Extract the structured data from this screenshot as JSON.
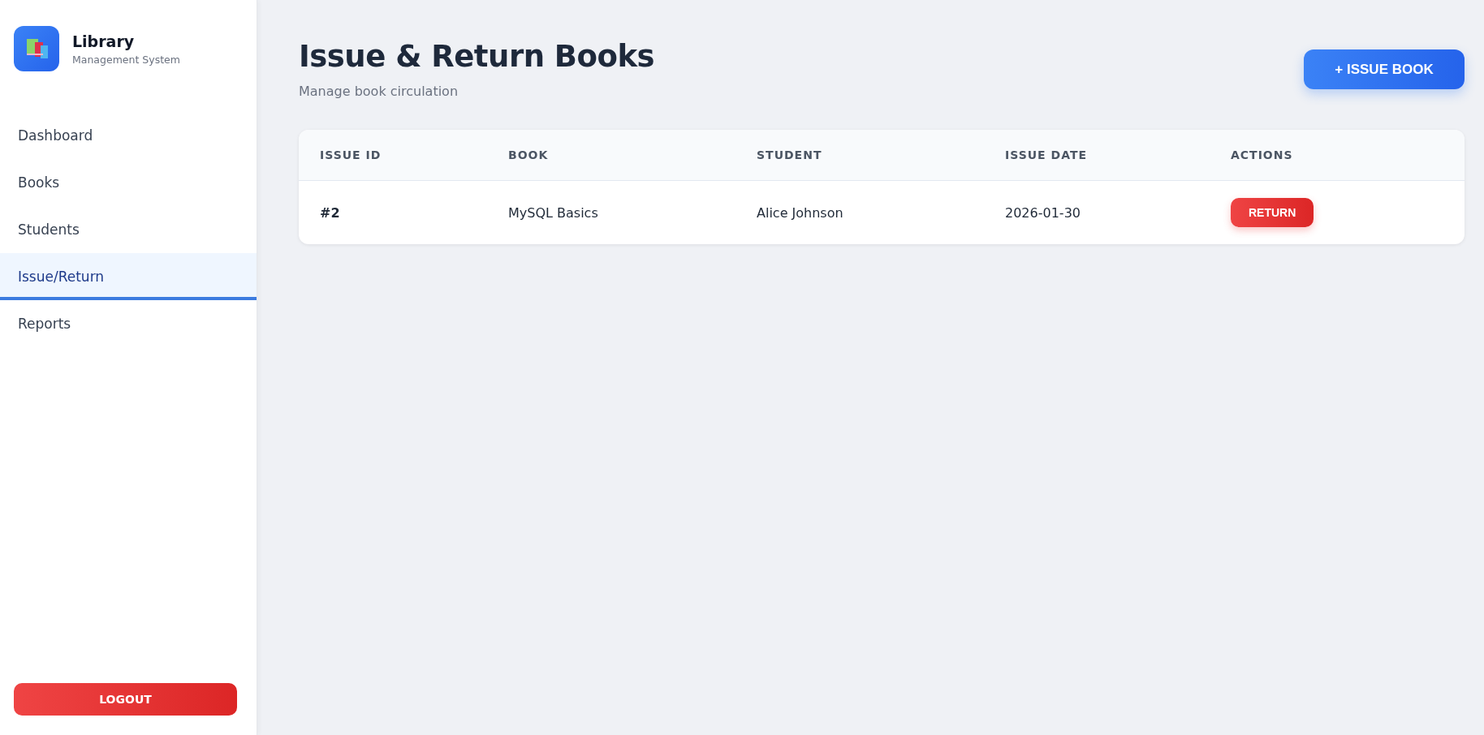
{
  "brand": {
    "title": "Library",
    "subtitle": "Management System"
  },
  "nav": [
    {
      "label": "Dashboard",
      "selected": false
    },
    {
      "label": "Books",
      "selected": false
    },
    {
      "label": "Students",
      "selected": false
    },
    {
      "label": "Issue/Return",
      "selected": true
    },
    {
      "label": "Reports",
      "selected": false
    }
  ],
  "logout": "LOGOUT",
  "page": {
    "title": "Issue & Return Books",
    "subtitle": "Manage book circulation",
    "action": "+ ISSUE BOOK"
  },
  "table": {
    "columns": [
      "ISSUE ID",
      "BOOK",
      "STUDENT",
      "ISSUE DATE",
      "ACTIONS"
    ],
    "rows": [
      {
        "id": "#2",
        "book": "MySQL Basics",
        "student": "Alice Johnson",
        "date": "2026-01-30",
        "action": "RETURN"
      }
    ]
  }
}
